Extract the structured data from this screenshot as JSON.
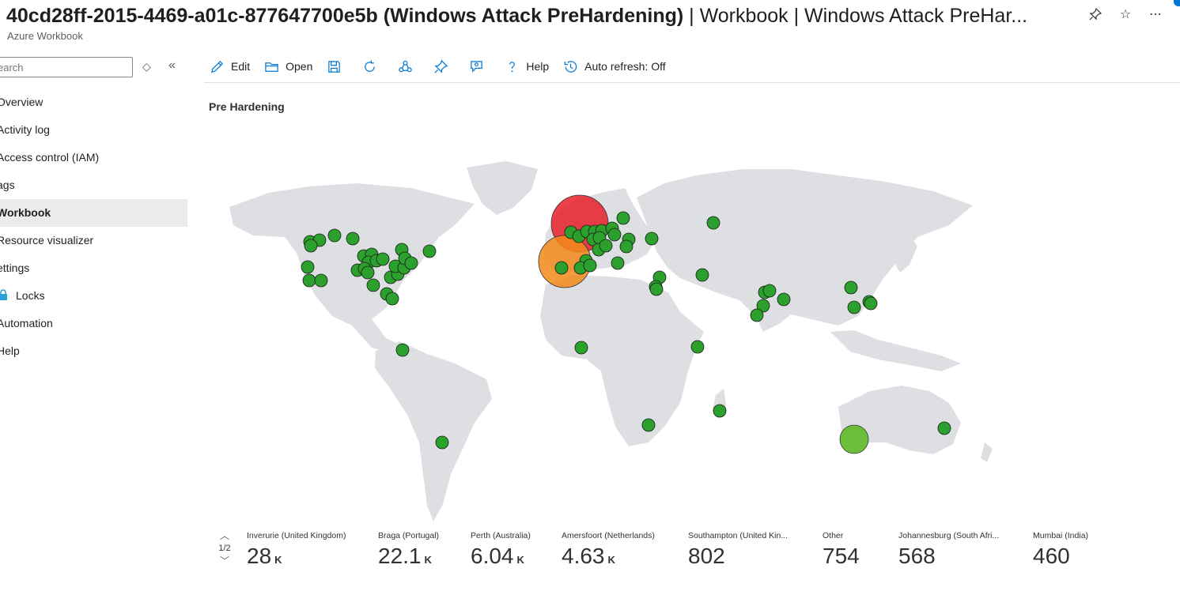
{
  "header": {
    "title_bold": "40cd28ff-2015-4469-a01c-877647700e5b (Windows Attack PreHardening)",
    "title_rest": " | Workbook | Windows Attack PreHar...",
    "subtitle": "Azure Workbook",
    "icons": [
      "pin-icon",
      "star-icon",
      "more-icon"
    ]
  },
  "sidebar": {
    "search_placeholder": "earch",
    "items": [
      {
        "label": "Overview"
      },
      {
        "label": "Activity log"
      },
      {
        "label": "Access control (IAM)"
      },
      {
        "label": "ags"
      },
      {
        "label": "Workbook",
        "active": true
      },
      {
        "label": "Resource visualizer"
      },
      {
        "label": "ettings"
      },
      {
        "label": "Locks",
        "icon": "lock-icon"
      },
      {
        "label": "Automation"
      },
      {
        "label": "Help"
      }
    ]
  },
  "toolbar": {
    "edit": "Edit",
    "open": "Open",
    "help": "Help",
    "auto_refresh": "Auto refresh: Off"
  },
  "section": {
    "title": "Pre Hardening"
  },
  "map": {
    "colors": {
      "land": "#dddfe3",
      "small": "#2ca02c",
      "medium": "#6cbf3a",
      "orange": "#f28a1a",
      "red": "#e8202a"
    }
  },
  "tiles": {
    "pager": "1/2",
    "items": [
      {
        "label": "Inverurie (United Kingdom)",
        "value": "28",
        "unit": "K"
      },
      {
        "label": "Braga (Portugal)",
        "value": "22.1",
        "unit": "K"
      },
      {
        "label": "Perth (Australia)",
        "value": "6.04",
        "unit": "K"
      },
      {
        "label": "Amersfoort (Netherlands)",
        "value": "4.63",
        "unit": "K"
      },
      {
        "label": "Southampton (United Kin...",
        "value": "802",
        "unit": ""
      },
      {
        "label": "Other",
        "value": "754",
        "unit": ""
      },
      {
        "label": "Johannesburg (South Afri...",
        "value": "568",
        "unit": ""
      },
      {
        "label": "Mumbai (India)",
        "value": "460",
        "unit": ""
      }
    ]
  }
}
